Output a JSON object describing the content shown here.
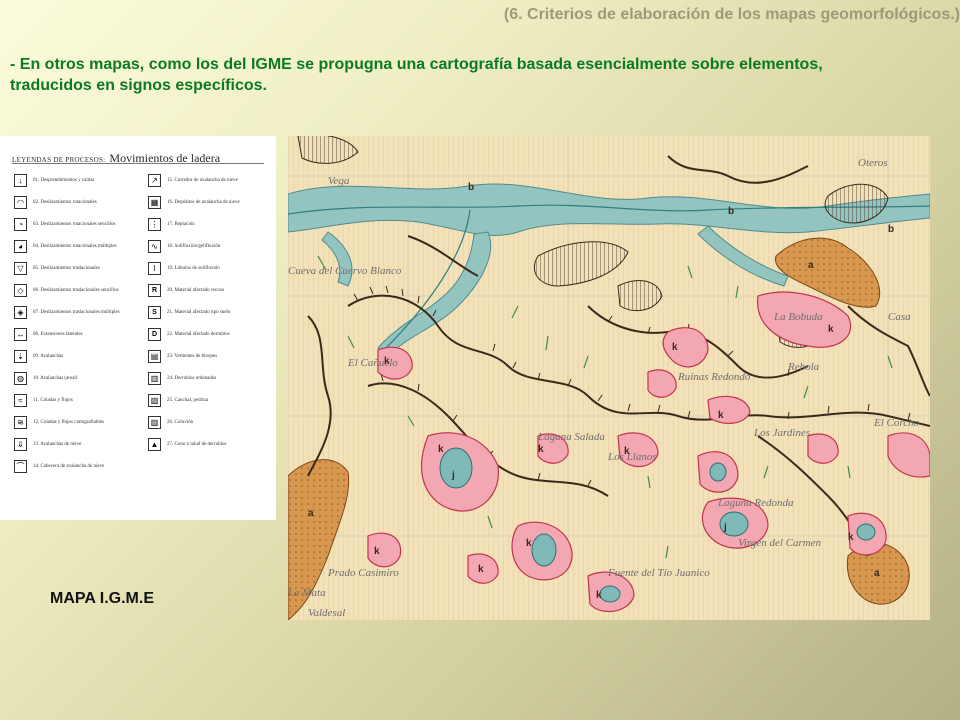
{
  "header": {
    "title": "(6. Criterios de elaboración de los mapas geomorfológicos.)"
  },
  "intro": {
    "text": "- En otros mapas, como los del IGME se propugna una cartografía basada esencialmente sobre elementos, traducidos en signos específicos."
  },
  "legend": {
    "title_prefix": "LEYENDAS DE PROCESOS:",
    "title": "Movimientos de ladera",
    "left_items": [
      {
        "label": "01. Desprendimientos y caídas",
        "icon": "rockfall-icon"
      },
      {
        "label": "02. Deslizamientos rotacionales",
        "icon": "rotational-slide-icon"
      },
      {
        "label": "03. Deslizamientos rotacionales sencillos",
        "icon": "simple-rotational-slide-icon"
      },
      {
        "label": "04. Deslizamientos rotacionales múltiples",
        "icon": "multiple-rotational-slide-icon"
      },
      {
        "label": "05. Deslizamientos traslacionales",
        "icon": "translational-slide-icon"
      },
      {
        "label": "06. Deslizamientos traslacionales sencillos",
        "icon": "simple-translational-slide-icon"
      },
      {
        "label": "07. Deslizamientos traslacionales múltiples",
        "icon": "multiple-translational-slide-icon"
      },
      {
        "label": "08. Extensiones laterales",
        "icon": "lateral-spread-icon"
      },
      {
        "label": "09. Avalanchas",
        "icon": "avalanche-icon"
      },
      {
        "label": "10. Avalanchas (areal)",
        "icon": "areal-avalanche-icon"
      },
      {
        "label": "11. Coladas y flujos",
        "icon": "flow-icon"
      },
      {
        "label": "12. Coladas y flujos cartografiables",
        "icon": "mappable-flow-icon"
      },
      {
        "label": "13. Avalanchas de nieve",
        "icon": "snow-avalanche-icon"
      },
      {
        "label": "14. Cabecera de avalancha de nieve",
        "icon": "snow-avalanche-head-icon"
      }
    ],
    "right_items": [
      {
        "label": "15. Corredor de avalancha de nieve",
        "icon": "avalanche-corridor-icon"
      },
      {
        "label": "16. Depósitos de avalancha de nieve",
        "icon": "avalanche-deposit-icon"
      },
      {
        "label": "17. Reptación",
        "icon": "creep-icon"
      },
      {
        "label": "18. Solifluxión/gelifluxión",
        "icon": "solifluction-icon"
      },
      {
        "label": "19. Lóbulos de solifluxión",
        "icon": "solifluction-lobes-icon"
      },
      {
        "label": "20. Material afectado rocoso",
        "symbol": "R"
      },
      {
        "label": "21. Material afectado tipo suelo",
        "symbol": "S"
      },
      {
        "label": "22. Material afectado derrubios",
        "symbol": "D"
      },
      {
        "label": "23. Vertientes de bloques",
        "icon": "block-slope-icon"
      },
      {
        "label": "24. Derrubios ordenados",
        "icon": "stratified-debris-icon"
      },
      {
        "label": "25. Canchal, pedriza",
        "icon": "scree-icon"
      },
      {
        "label": "26. Coluvión",
        "icon": "colluvium-icon"
      },
      {
        "label": "27. Cono o talud de derrubios",
        "icon": "debris-cone-icon"
      }
    ]
  },
  "map": {
    "caption": "MAPA I.G.M.E",
    "place_names": [
      "Vega",
      "Cueva del Cuervo Blanco",
      "La Bobuda",
      "Rebola",
      "El Corcho",
      "Los Llanos",
      "Laguna Salada",
      "Laguna Redonda",
      "Prado Casimiro",
      "Valdesal",
      "Fuente del Tío Juanico",
      "Casa",
      "Oteros",
      "El Cañuelo",
      "Los Jardines",
      "Ruinas Redondo",
      "Virgen del Carmen",
      "La Mata"
    ],
    "symbols": [
      "k",
      "b",
      "a",
      "j"
    ],
    "colors": {
      "paper": "#f3e1b8",
      "valley": "#8fc0bd",
      "karst": "#f3a7b3",
      "karst_edge": "#c2344e",
      "slope": "#c78a52",
      "scarp": "#3a2a1c"
    }
  }
}
